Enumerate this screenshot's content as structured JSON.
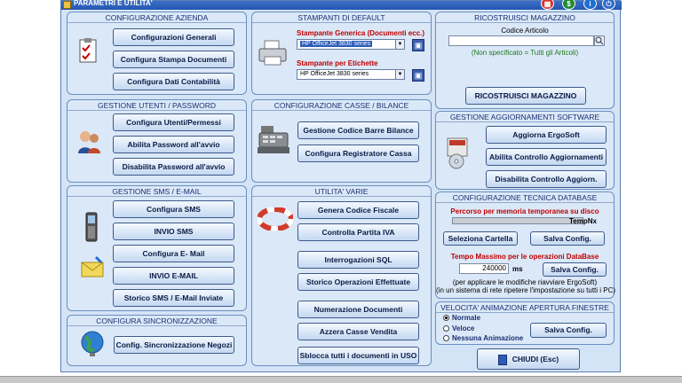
{
  "window": {
    "title": "PARAMETRI E UTILITA'"
  },
  "titlebar_buttons": [
    {
      "icon": "calendar-icon",
      "color": "#d9322a"
    },
    {
      "icon": "dollar-icon",
      "color": "#1f8a2e"
    },
    {
      "icon": "info-icon",
      "color": "#1f6fd0"
    },
    {
      "icon": "power-icon",
      "color": "#2b6acb"
    }
  ],
  "azienda": {
    "title": "CONFIGURAZIONE AZIENDA",
    "buttons": [
      "Configurazioni Generali",
      "Configura Stampa Documenti",
      "Configura Dati Contabilità"
    ]
  },
  "stampanti": {
    "title": "STAMPANTI DI DEFAULT",
    "generica_label": "Stampante Generica (Documenti ecc.)",
    "generica_value": "HP OfficeJet 3830 series",
    "etichette_label": "Stampante per Etichette",
    "etichette_value": "HP OfficeJet 3830 series"
  },
  "magazzino": {
    "title": "RICOSTRUISCI MAGAZZINO",
    "codice_label": "Codice Articolo",
    "codice_value": "",
    "hint": "(Non specificato = Tutti gli Articoli)",
    "button": "RICOSTRUISCI MAGAZZINO"
  },
  "utenti": {
    "title": "GESTIONE UTENTI / PASSWORD",
    "buttons": [
      "Configura Utenti/Permessi",
      "Abilita Password all'avvio",
      "Disabilita Password all'avvio"
    ]
  },
  "casse": {
    "title": "CONFIGURAZIONE CASSE / BILANCE",
    "buttons": [
      "Gestione Codice Barre Bilance",
      "Configura Registratore Cassa"
    ]
  },
  "aggiornamenti": {
    "title": "GESTIONE AGGIORNAMENTI SOFTWARE",
    "buttons": [
      "Aggiorna ErgoSoft",
      "Abilita Controllo Aggiornamenti",
      "Disabilita Controllo Aggiorn."
    ]
  },
  "sms": {
    "title": "GESTIONE SMS / E-MAIL",
    "buttons": [
      "Configura SMS",
      "INVIO SMS",
      "Configura E- Mail",
      "INVIO E-MAIL",
      "Storico SMS / E-Mail Inviate"
    ]
  },
  "utilita": {
    "title": "UTILITA' VARIE",
    "buttons": [
      "Genera Codice Fiscale",
      "Controlla Partita IVA",
      "Interrogazioni SQL",
      "Storico Operazioni Effettuate",
      "Numerazione Documenti",
      "Azzera Casse Vendita",
      "Sblocca tutti i documenti in USO"
    ]
  },
  "database": {
    "title": "CONFIGURAZIONE TECNICA DATABASE",
    "percorso_label": "Percorso per memoria temporanea su disco",
    "percorso_value": "",
    "tempnx": "TempNx",
    "seleziona": "Seleziona Cartella",
    "salva1": "Salva Config.",
    "tempo_label": "Tempo Massimo per le operazioni DataBase",
    "tempo_value": "240000",
    "ms": "ms",
    "salva2": "Salva Config.",
    "note1": "(per applicare le modifiche riavviare ErgoSoft)",
    "note2": "(in un sistema di rete ripetere l'impostazione su tutti i PC)"
  },
  "velocita": {
    "title": "VELOCITA' ANIMAZIONE APERTURA FINESTRE",
    "options": [
      "Normale",
      "Veloce",
      "Nessuna Animazione"
    ],
    "selected": "Normale",
    "salva": "Salva Config."
  },
  "sincro": {
    "title": "CONFIGURA SINCRONIZZAZIONE",
    "button": "Config. Sincronizzazione Negozi"
  },
  "chiudi": "CHIUDI  (Esc)"
}
